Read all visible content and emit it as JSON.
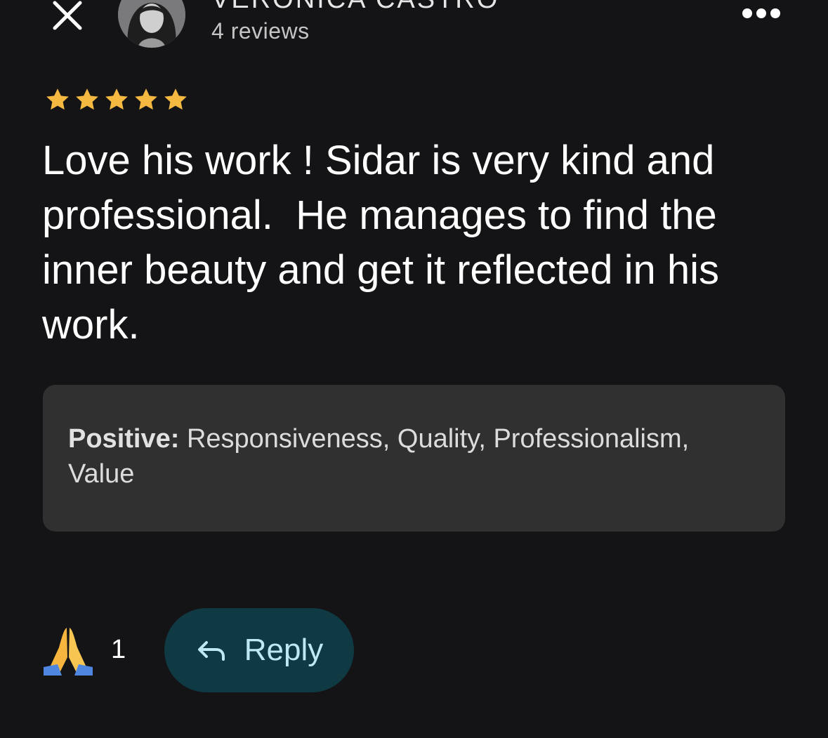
{
  "header": {
    "reviewer_name": "VERONICA CASTRO",
    "review_count": "4 reviews",
    "close_icon": "close-icon",
    "more_icon": "more-horizontal-icon"
  },
  "review": {
    "rating": 5,
    "rating_max": 5,
    "star_color": "#f5b841",
    "text": "Love his work ! Sidar is very kind and professional.  He manages to find the inner beauty and get it reflected in his work."
  },
  "attributes": {
    "label": "Positive:",
    "values": " Responsiveness, Quality, Professionalism, Value"
  },
  "actions": {
    "reaction_icon": "praying-hands-icon",
    "reaction_count": "1",
    "reply_icon": "reply-arrow-icon",
    "reply_label": "Reply"
  },
  "colors": {
    "background": "#141417",
    "card": "#303030",
    "reply_button_bg": "#0f3a44",
    "reply_button_text": "#bde9f4"
  }
}
